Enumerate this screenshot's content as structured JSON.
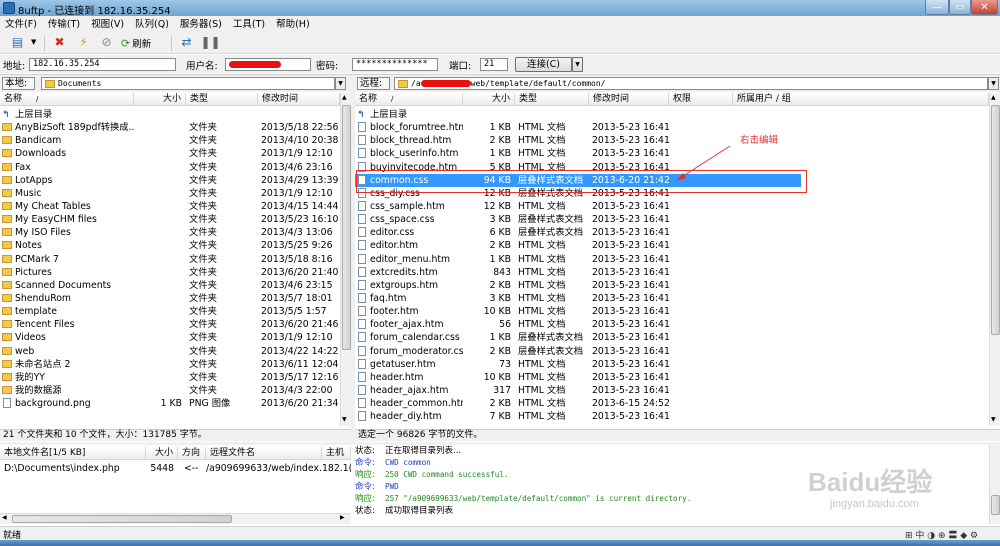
{
  "window": {
    "title": "8uftp - 已连接到 182.16.35.254"
  },
  "menu": [
    "文件(F)",
    "传输(T)",
    "视图(V)",
    "队列(Q)",
    "服务器(S)",
    "工具(T)",
    "帮助(H)"
  ],
  "toolbar": {
    "refresh_label": "刷新"
  },
  "connect": {
    "addr_label": "地址:",
    "addr_value": "182.16.35.254",
    "user_label": "用户名:",
    "pass_label": "密码:",
    "pass_value": "**************",
    "port_label": "端口:",
    "port_value": "21",
    "connect_label": "连接(C)"
  },
  "local": {
    "label": "本地:",
    "path": "Documents",
    "columns": [
      "名称",
      "大小",
      "类型",
      "修改时间"
    ],
    "rows": [
      {
        "name": "上层目录",
        "size": "",
        "type": "",
        "date": "",
        "icon": "up"
      },
      {
        "name": "AnyBizSoft 189pdf转换成...",
        "size": "",
        "type": "文件夹",
        "date": "2013/5/18 22:56",
        "icon": "folder"
      },
      {
        "name": "Bandicam",
        "size": "",
        "type": "文件夹",
        "date": "2013/4/10 20:38",
        "icon": "folder"
      },
      {
        "name": "Downloads",
        "size": "",
        "type": "文件夹",
        "date": "2013/1/9 12:10",
        "icon": "folder"
      },
      {
        "name": "Fax",
        "size": "",
        "type": "文件夹",
        "date": "2013/4/6 23:16",
        "icon": "folder"
      },
      {
        "name": "LotApps",
        "size": "",
        "type": "文件夹",
        "date": "2013/4/29 13:39",
        "icon": "folder"
      },
      {
        "name": "Music",
        "size": "",
        "type": "文件夹",
        "date": "2013/1/9 12:10",
        "icon": "folder"
      },
      {
        "name": "My Cheat Tables",
        "size": "",
        "type": "文件夹",
        "date": "2013/4/15 14:44",
        "icon": "folder"
      },
      {
        "name": "My EasyCHM files",
        "size": "",
        "type": "文件夹",
        "date": "2013/5/23 16:10",
        "icon": "folder"
      },
      {
        "name": "My ISO Files",
        "size": "",
        "type": "文件夹",
        "date": "2013/4/3 13:06",
        "icon": "folder"
      },
      {
        "name": "Notes",
        "size": "",
        "type": "文件夹",
        "date": "2013/5/25 9:26",
        "icon": "folder"
      },
      {
        "name": "PCMark 7",
        "size": "",
        "type": "文件夹",
        "date": "2013/5/18 8:16",
        "icon": "folder"
      },
      {
        "name": "Pictures",
        "size": "",
        "type": "文件夹",
        "date": "2013/6/20 21:40",
        "icon": "folder"
      },
      {
        "name": "Scanned Documents",
        "size": "",
        "type": "文件夹",
        "date": "2013/4/6 23:15",
        "icon": "folder"
      },
      {
        "name": "ShenduRom",
        "size": "",
        "type": "文件夹",
        "date": "2013/5/7 18:01",
        "icon": "folder"
      },
      {
        "name": "template",
        "size": "",
        "type": "文件夹",
        "date": "2013/5/5 1:57",
        "icon": "folder"
      },
      {
        "name": "Tencent Files",
        "size": "",
        "type": "文件夹",
        "date": "2013/6/20 21:46",
        "icon": "folder"
      },
      {
        "name": "Videos",
        "size": "",
        "type": "文件夹",
        "date": "2013/1/9 12:10",
        "icon": "folder"
      },
      {
        "name": "web",
        "size": "",
        "type": "文件夹",
        "date": "2013/4/22 14:22",
        "icon": "folder"
      },
      {
        "name": "未命名站点 2",
        "size": "",
        "type": "文件夹",
        "date": "2013/6/11 12:04",
        "icon": "folder"
      },
      {
        "name": "我的YY",
        "size": "",
        "type": "文件夹",
        "date": "2013/5/17 12:16",
        "icon": "folder"
      },
      {
        "name": "我的数据源",
        "size": "",
        "type": "文件夹",
        "date": "2013/4/3 22:00",
        "icon": "folder"
      },
      {
        "name": "background.png",
        "size": "1 KB",
        "type": "PNG 图像",
        "date": "2013/6/20 21:34",
        "icon": "file"
      }
    ],
    "status": "21 个文件夹和 10 个文件，大小：131785 字节。"
  },
  "remote": {
    "label": "远程:",
    "path_suffix": "web/template/default/common/",
    "columns": [
      "名称",
      "大小",
      "类型",
      "修改时间",
      "权限",
      "所属用户 / 组"
    ],
    "rows": [
      {
        "name": "上层目录",
        "size": "",
        "type": "",
        "date": "",
        "icon": "up"
      },
      {
        "name": "block_forumtree.htm",
        "size": "1 KB",
        "type": "HTML 文档",
        "date": "2013-5-23 16:41",
        "icon": "file"
      },
      {
        "name": "block_thread.htm",
        "size": "2 KB",
        "type": "HTML 文档",
        "date": "2013-5-23 16:41",
        "icon": "file"
      },
      {
        "name": "block_userinfo.htm",
        "size": "1 KB",
        "type": "HTML 文档",
        "date": "2013-5-23 16:41",
        "icon": "file"
      },
      {
        "name": "buyinvitecode.htm",
        "size": "5 KB",
        "type": "HTML 文档",
        "date": "2013-5-23 16:41",
        "icon": "file"
      },
      {
        "name": "common.css",
        "size": "94 KB",
        "type": "层叠样式表文档",
        "date": "2013-6-20 21:42",
        "icon": "file"
      },
      {
        "name": "css_diy.css",
        "size": "12 KB",
        "type": "层叠样式表文档",
        "date": "2013-5-23 16:41",
        "icon": "file"
      },
      {
        "name": "css_sample.htm",
        "size": "12 KB",
        "type": "HTML 文档",
        "date": "2013-5-23 16:41",
        "icon": "file"
      },
      {
        "name": "css_space.css",
        "size": "3 KB",
        "type": "层叠样式表文档",
        "date": "2013-5-23 16:41",
        "icon": "file"
      },
      {
        "name": "editor.css",
        "size": "6 KB",
        "type": "层叠样式表文档",
        "date": "2013-5-23 16:41",
        "icon": "file"
      },
      {
        "name": "editor.htm",
        "size": "2 KB",
        "type": "HTML 文档",
        "date": "2013-5-23 16:41",
        "icon": "file"
      },
      {
        "name": "editor_menu.htm",
        "size": "1 KB",
        "type": "HTML 文档",
        "date": "2013-5-23 16:41",
        "icon": "file"
      },
      {
        "name": "extcredits.htm",
        "size": "843",
        "type": "HTML 文档",
        "date": "2013-5-23 16:41",
        "icon": "file"
      },
      {
        "name": "extgroups.htm",
        "size": "2 KB",
        "type": "HTML 文档",
        "date": "2013-5-23 16:41",
        "icon": "file"
      },
      {
        "name": "faq.htm",
        "size": "3 KB",
        "type": "HTML 文档",
        "date": "2013-5-23 16:41",
        "icon": "file"
      },
      {
        "name": "footer.htm",
        "size": "10 KB",
        "type": "HTML 文档",
        "date": "2013-5-23 16:41",
        "icon": "file"
      },
      {
        "name": "footer_ajax.htm",
        "size": "56",
        "type": "HTML 文档",
        "date": "2013-5-23 16:41",
        "icon": "file"
      },
      {
        "name": "forum_calendar.css",
        "size": "1 KB",
        "type": "层叠样式表文档",
        "date": "2013-5-23 16:41",
        "icon": "file"
      },
      {
        "name": "forum_moderator.css",
        "size": "2 KB",
        "type": "层叠样式表文档",
        "date": "2013-5-23 16:41",
        "icon": "file"
      },
      {
        "name": "getatuser.htm",
        "size": "73",
        "type": "HTML 文档",
        "date": "2013-5-23 16:41",
        "icon": "file"
      },
      {
        "name": "header.htm",
        "size": "10 KB",
        "type": "HTML 文档",
        "date": "2013-5-23 16:41",
        "icon": "file"
      },
      {
        "name": "header_ajax.htm",
        "size": "317",
        "type": "HTML 文档",
        "date": "2013-5-23 16:41",
        "icon": "file"
      },
      {
        "name": "header_common.htm",
        "size": "2 KB",
        "type": "HTML 文档",
        "date": "2013-6-15 24:52",
        "icon": "file"
      },
      {
        "name": "header_diy.htm",
        "size": "7 KB",
        "type": "HTML 文档",
        "date": "2013-5-23 16:41",
        "icon": "file"
      }
    ],
    "status": "选定一个 96826 字节的文件。",
    "annotation": "右击编辑"
  },
  "queue": {
    "columns": [
      "本地文件名[1/5 KB]",
      "大小",
      "方向",
      "远程文件名",
      "主机"
    ],
    "row": {
      "local": "D:\\Documents\\index.php",
      "size": "5448",
      "dir": "<--",
      "remote": "/a909699633/web/index....",
      "host": "182.1("
    }
  },
  "log": [
    {
      "label": "状态:",
      "text": "正在取得目录列表...",
      "color": "#000000"
    },
    {
      "label": "命令:",
      "text": "CWD common",
      "color": "#1f3fbf"
    },
    {
      "label": "响应:",
      "text": "250 CWD command successful.",
      "color": "#1f8a1f"
    },
    {
      "label": "命令:",
      "text": "PWD",
      "color": "#1f3fbf"
    },
    {
      "label": "响应:",
      "text": "257 \"/a909699633/web/template/default/common\" is current directory.",
      "color": "#1f8a1f"
    },
    {
      "label": "状态:",
      "text": "成功取得目录列表",
      "color": "#000000"
    }
  ],
  "watermark": {
    "brand": "Baidu经验",
    "url": "jingyan.baidu.com"
  },
  "statusbar": {
    "text": "就绪"
  }
}
